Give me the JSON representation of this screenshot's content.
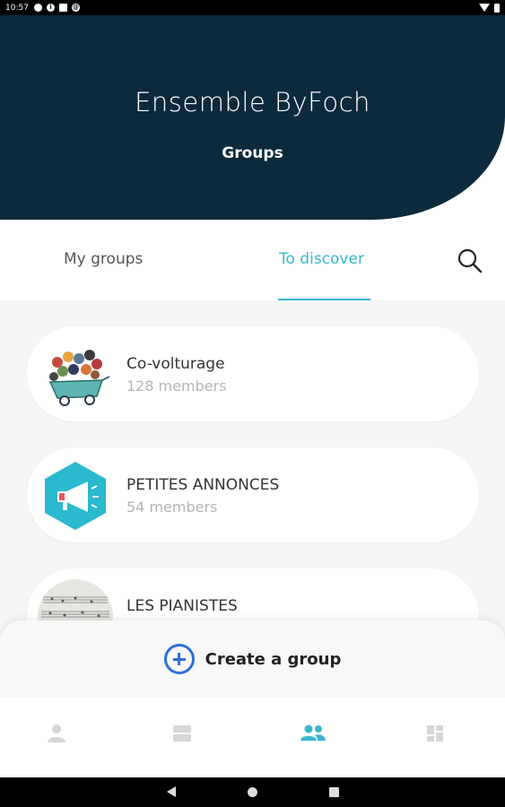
{
  "status_bar": {
    "time": "10:57",
    "icons": [
      "circle-icon",
      "info-icon",
      "storage-icon",
      "media-icon"
    ]
  },
  "header": {
    "app_title": "Ensemble ByFoch",
    "page_title": "Groups",
    "background_color": "#0b2a3c"
  },
  "tabs": {
    "items": [
      {
        "label": "My groups",
        "active": false
      },
      {
        "label": "To discover",
        "active": true
      }
    ],
    "active_color": "#38b8cf",
    "search_icon": "search-icon"
  },
  "groups": [
    {
      "name": "Co-volturage",
      "members": "128 members",
      "avatar": "carpool-illustration"
    },
    {
      "name": "PETITES ANNONCES",
      "members": "54 members",
      "avatar": "megaphone-hexagon-icon"
    },
    {
      "name": "LES PIANISTES",
      "members": "",
      "avatar": "sheet-music-image"
    }
  ],
  "create_group": {
    "label": "Create a group",
    "icon": "plus-circle-icon",
    "accent": "#2e6fd9"
  },
  "bottom_nav": {
    "items": [
      {
        "icon": "profile-icon",
        "active": false
      },
      {
        "icon": "feed-icon",
        "active": false
      },
      {
        "icon": "groups-icon",
        "active": true
      },
      {
        "icon": "apps-icon",
        "active": false
      }
    ],
    "active_color": "#38b8cf",
    "inactive_color": "#d6d6d6"
  }
}
